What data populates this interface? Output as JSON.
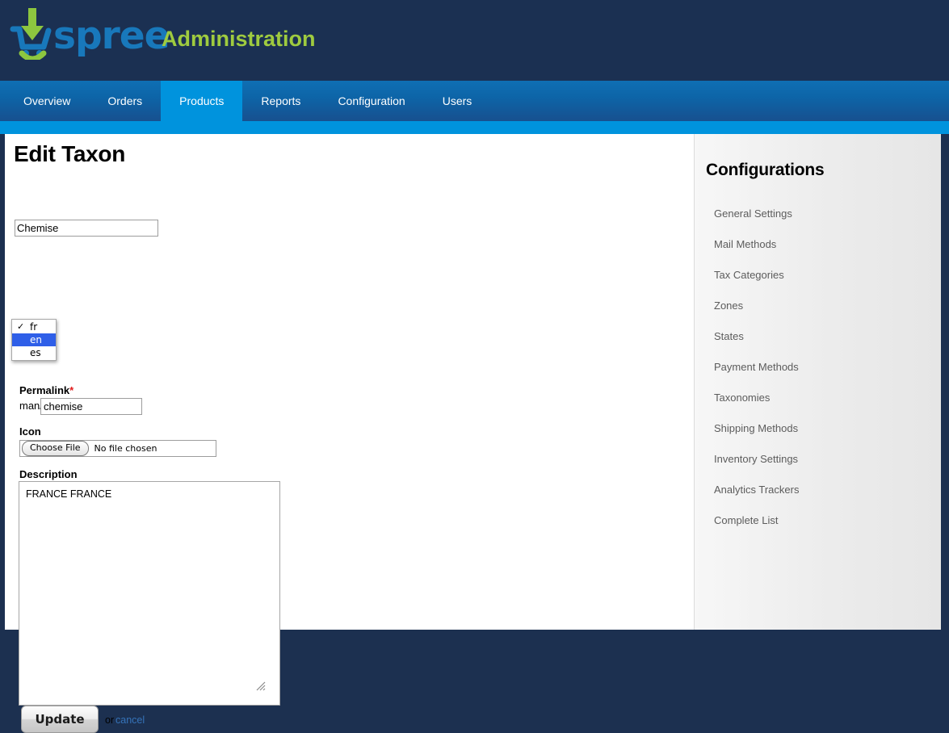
{
  "header": {
    "logo_icon": "spree-cart-logo-icon",
    "brand": "spree",
    "admin_label": "Administration",
    "brand_color": "#1878bb",
    "admin_color": "#9fcb3f",
    "background_color": "#1b3052"
  },
  "nav": {
    "active_tab": "Products",
    "active_color": "#0093dd",
    "tabs": [
      {
        "label": "Overview"
      },
      {
        "label": "Orders"
      },
      {
        "label": "Products"
      },
      {
        "label": "Reports"
      },
      {
        "label": "Configuration"
      },
      {
        "label": "Users"
      }
    ]
  },
  "main": {
    "page_title": "Edit Taxon",
    "name_field": {
      "value": "Chemise"
    },
    "language_dropdown": {
      "options": [
        {
          "label": "fr",
          "checked": true,
          "highlighted": false
        },
        {
          "label": "en",
          "checked": false,
          "highlighted": true
        },
        {
          "label": "es",
          "checked": false,
          "highlighted": false
        }
      ],
      "highlight_color": "#2f5fe8"
    },
    "permalink": {
      "label": "Permalink",
      "required_marker": "*",
      "prefix": "man/",
      "value": "chemise"
    },
    "icon": {
      "label": "Icon",
      "button_label": "Choose File",
      "file_status": "No file chosen"
    },
    "description": {
      "label": "Description",
      "value": "FRANCE FRANCE"
    },
    "actions": {
      "submit_label": "Update",
      "or_label": "or",
      "cancel_label": "cancel",
      "cancel_color": "#3573b9"
    }
  },
  "sidebar": {
    "title": "Configurations",
    "items": [
      {
        "label": "General Settings"
      },
      {
        "label": "Mail Methods"
      },
      {
        "label": "Tax Categories"
      },
      {
        "label": "Zones"
      },
      {
        "label": "States"
      },
      {
        "label": "Payment Methods"
      },
      {
        "label": "Taxonomies"
      },
      {
        "label": "Shipping Methods"
      },
      {
        "label": "Inventory Settings"
      },
      {
        "label": "Analytics Trackers"
      },
      {
        "label": "Complete List"
      }
    ]
  }
}
